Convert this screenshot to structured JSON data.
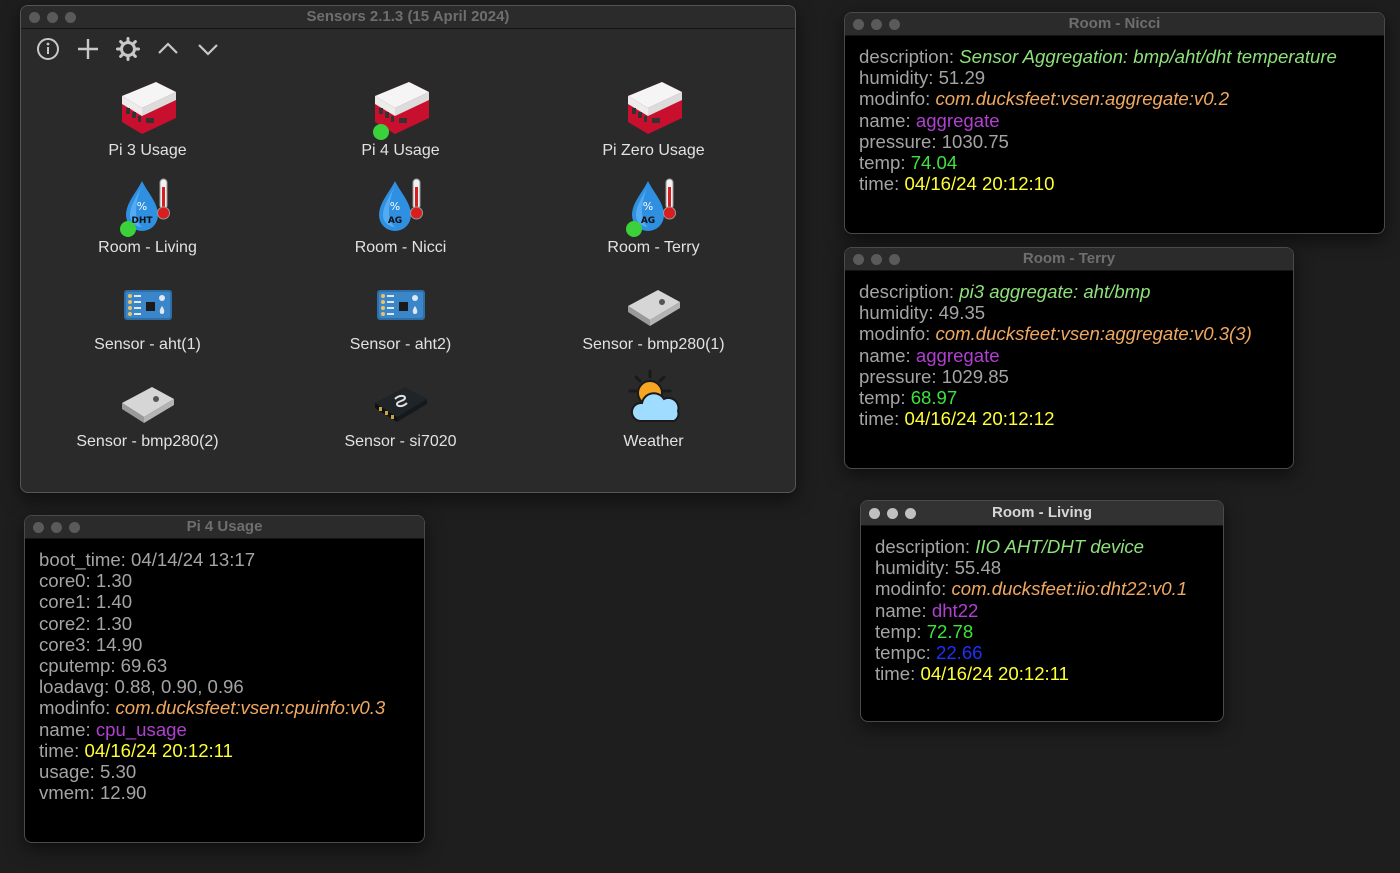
{
  "main_window": {
    "title": "Sensors 2.1.3 (15 April 2024)",
    "toolbar": [
      {
        "icon": "info-icon"
      },
      {
        "icon": "plus-icon"
      },
      {
        "icon": "gear-icon"
      },
      {
        "icon": "chevron-up-icon"
      },
      {
        "icon": "chevron-down-icon"
      }
    ],
    "items": [
      {
        "label": "Pi 3 Usage",
        "icon": "raspberry-pi-case-icon",
        "active": false
      },
      {
        "label": "Pi 4 Usage",
        "icon": "raspberry-pi-case-icon",
        "active": true
      },
      {
        "label": "Pi Zero Usage",
        "icon": "raspberry-pi-case-icon",
        "active": false
      },
      {
        "label": "Room - Living",
        "icon": "humidity-temperature-icon",
        "badge": "DHT",
        "active": true
      },
      {
        "label": "Room - Nicci",
        "icon": "humidity-temperature-icon",
        "badge": "AG",
        "active": false
      },
      {
        "label": "Room - Terry",
        "icon": "humidity-temperature-icon",
        "badge": "AG",
        "active": true
      },
      {
        "label": "Sensor - aht(1)",
        "icon": "sensor-board-icon",
        "active": false
      },
      {
        "label": "Sensor - aht2)",
        "icon": "sensor-board-icon",
        "active": false
      },
      {
        "label": "Sensor - bmp280(1)",
        "icon": "bmp280-chip-icon",
        "active": false
      },
      {
        "label": "Sensor - bmp280(2)",
        "icon": "bmp280-chip-icon",
        "active": false
      },
      {
        "label": "Sensor - si7020",
        "icon": "si7020-chip-icon",
        "active": false
      },
      {
        "label": "Weather",
        "icon": "sun-cloud-icon",
        "active": false
      }
    ]
  },
  "windows": {
    "nicci": {
      "title": "Room - Nicci",
      "description": "Sensor Aggregation: bmp/aht/dht temperature",
      "humidity": "51.29",
      "modinfo": "com.ducksfeet:vsen:aggregate:v0.2",
      "name": "aggregate",
      "pressure": "1030.75",
      "temp": "74.04",
      "time": "04/16/24 20:12:10"
    },
    "terry": {
      "title": "Room - Terry",
      "description": "pi3 aggregate: aht/bmp",
      "humidity": "49.35",
      "modinfo": "com.ducksfeet:vsen:aggregate:v0.3(3)",
      "name": "aggregate",
      "pressure": "1029.85",
      "temp": "68.97",
      "time": "04/16/24 20:12:12"
    },
    "living": {
      "title": "Room - Living",
      "description": "IIO AHT/DHT device",
      "humidity": "55.48",
      "modinfo": "com.ducksfeet:iio:dht22:v0.1",
      "name": "dht22",
      "temp": "72.78",
      "tempc": "22.66",
      "time": "04/16/24 20:12:11"
    },
    "pi4": {
      "title": "Pi 4 Usage",
      "boot_time": "04/14/24 13:17",
      "core0": "1.30",
      "core1": "1.40",
      "core2": "1.30",
      "core3": "14.90",
      "cputemp": "69.63",
      "loadavg": "0.88, 0.90, 0.96",
      "modinfo": "com.ducksfeet:vsen:cpuinfo:v0.3",
      "name": "cpu_usage",
      "time": "04/16/24 20:12:11",
      "usage": "5.30",
      "vmem": "12.90"
    }
  },
  "keys": {
    "description": "description",
    "humidity": "humidity",
    "modinfo": "modinfo",
    "name": "name",
    "pressure": "pressure",
    "temp": "temp",
    "tempc": "tempc",
    "time": "time",
    "boot_time": "boot_time",
    "core0": "core0",
    "core1": "core1",
    "core2": "core2",
    "core3": "core3",
    "cputemp": "cputemp",
    "loadavg": "loadavg",
    "usage": "usage",
    "vmem": "vmem"
  },
  "sep": ": "
}
